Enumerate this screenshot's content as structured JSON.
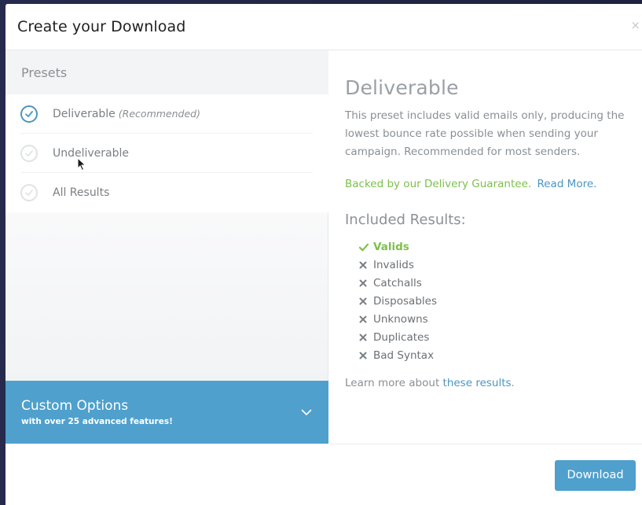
{
  "modal": {
    "title": "Create your Download",
    "close_label": "×"
  },
  "presets": {
    "header": "Presets",
    "items": [
      {
        "label": "Deliverable",
        "note": "(Recommended)",
        "selected": true
      },
      {
        "label": "Undeliverable",
        "note": "",
        "selected": false
      },
      {
        "label": "All Results",
        "note": "",
        "selected": false
      }
    ]
  },
  "custom_options": {
    "title": "Custom Options",
    "subtitle": "with over 25 advanced features!",
    "icon": "chevron-down-icon"
  },
  "detail": {
    "title": "Deliverable",
    "description": "This preset includes valid emails only, producing the lowest bounce rate possible when sending your campaign. Recommended for most senders.",
    "guarantee_text": "Backed by our Delivery Guarantee.",
    "guarantee_link": "Read More.",
    "included_heading": "Included Results:",
    "results": [
      {
        "label": "Valids",
        "included": true
      },
      {
        "label": "Invalids",
        "included": false
      },
      {
        "label": "Catchalls",
        "included": false
      },
      {
        "label": "Disposables",
        "included": false
      },
      {
        "label": "Unknowns",
        "included": false
      },
      {
        "label": "Duplicates",
        "included": false
      },
      {
        "label": "Bad Syntax",
        "included": false
      }
    ],
    "learn_prefix": "Learn more about",
    "learn_link": "these results",
    "learn_suffix": "."
  },
  "footer": {
    "download_label": "Download"
  },
  "colors": {
    "accent_blue": "#4fa0cd",
    "link_blue": "#4c95c1",
    "success_green": "#7cc04b",
    "backdrop": "#232846"
  }
}
